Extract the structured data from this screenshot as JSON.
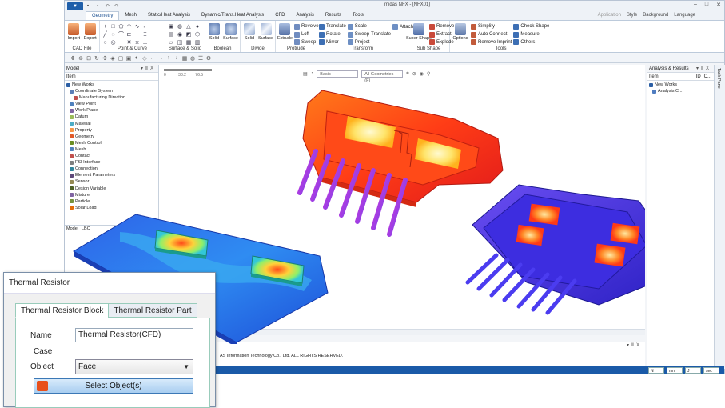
{
  "window": {
    "title": "midas NFX - [NFX01]",
    "app_menu": "▼"
  },
  "tabs": [
    "Geometry",
    "Mesh",
    "Static/Heat Analysis",
    "Dynamic/Trans.Heat Analysis",
    "CFD",
    "Analysis",
    "Results",
    "Tools"
  ],
  "tab_right": [
    "Application",
    "Style",
    "Background",
    "Language"
  ],
  "ribbon": {
    "cad_file": {
      "label": "CAD File",
      "import": "Import",
      "export": "Export"
    },
    "point_curve": {
      "label": "Point & Curve"
    },
    "surface_solid": {
      "label": "Surface & Solid"
    },
    "boolean": {
      "label": "Boolean",
      "solid": "Solid",
      "surface": "Surface"
    },
    "divide": {
      "label": "Divide",
      "solid": "Solid",
      "surface": "Surface"
    },
    "protrude": {
      "label": "Protrude",
      "extrude": "Extrude",
      "revolve": "Revolve",
      "loft": "Loft",
      "sweep": "Sweep"
    },
    "transform": {
      "label": "Transform",
      "translate": "Translate",
      "rotate": "Rotate",
      "mirror": "Mirror",
      "scale": "Scale",
      "sweep_translate": "Sweep-Translate",
      "project": "Project",
      "attach": "Attach"
    },
    "sub_shape": {
      "label": "Sub Shape",
      "super_shape": "Super Shape",
      "remove": "Remove",
      "extract": "Extract",
      "explode": "Explode"
    },
    "tools": {
      "label": "Tools",
      "options": "Options",
      "simplify": "Simplify",
      "auto_connect": "Auto Connect",
      "remove_imprint": "Remove Imprint",
      "check_shape": "Check Shape",
      "measure": "Measure",
      "others": "Others"
    }
  },
  "model_panel": {
    "title": "Model",
    "column": "Item",
    "bottom_tabs": [
      "Model",
      "LBC"
    ],
    "items": [
      {
        "label": "New Works",
        "level": 0
      },
      {
        "label": "Coordinate System",
        "level": 1
      },
      {
        "label": "Manufacturing Direction",
        "level": 2
      },
      {
        "label": "View Point",
        "level": 1
      },
      {
        "label": "Work Plane",
        "level": 1
      },
      {
        "label": "Datum",
        "level": 1
      },
      {
        "label": "Material",
        "level": 1
      },
      {
        "label": "Property",
        "level": 1
      },
      {
        "label": "Geometry",
        "level": 1
      },
      {
        "label": "Mesh Control",
        "level": 1
      },
      {
        "label": "Mesh",
        "level": 1
      },
      {
        "label": "Contact",
        "level": 1
      },
      {
        "label": "FSI Interface",
        "level": 1
      },
      {
        "label": "Connection",
        "level": 1
      },
      {
        "label": "Element Parameters",
        "level": 1
      },
      {
        "label": "Sensor",
        "level": 1
      },
      {
        "label": "Design Variable",
        "level": 1
      },
      {
        "label": "Mixture",
        "level": 1
      },
      {
        "label": "Particle",
        "level": 1
      },
      {
        "label": "Solar Load",
        "level": 1
      }
    ]
  },
  "viewport": {
    "display_mode": "Basic",
    "filter": "All Geometries (F)",
    "ruler": [
      "0",
      "38.2",
      "76.5"
    ]
  },
  "analysis_panel": {
    "title": "Analysis & Results",
    "col_item": "Item",
    "col_id": "ID",
    "col_c": "C...",
    "items": [
      "New Works",
      "Analysis C..."
    ]
  },
  "task_pane": "Task Pane",
  "output": {
    "line": "AS Information Technology Co., Ltd. ALL RIGHTS RESERVED."
  },
  "status": {
    "units": [
      "N",
      "mm",
      "J",
      "sec"
    ]
  },
  "dialog": {
    "title": "Thermal Resistor",
    "tabs": [
      "Thermal Resistor Block",
      "Thermal Resistor Part"
    ],
    "name_label": "Name",
    "name_value": "Thermal Resistor(CFD)",
    "case_label": "Case",
    "object_label": "Object",
    "object_value": "Face",
    "select_button": "Select Object(s)"
  }
}
